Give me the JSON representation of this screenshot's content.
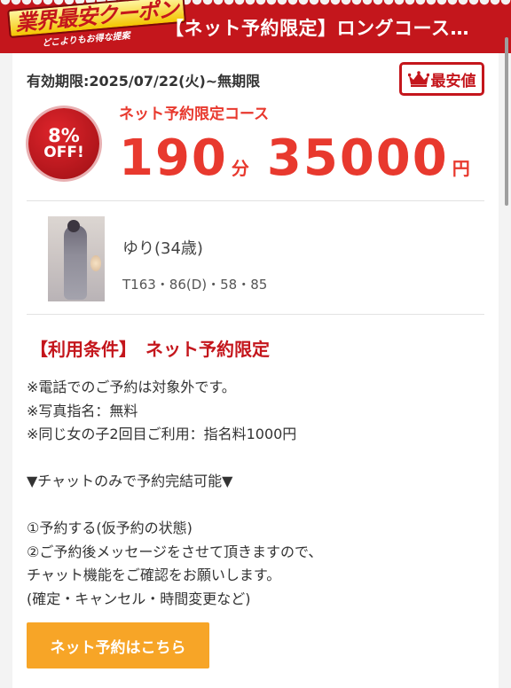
{
  "header": {
    "banner_main": "業界最安クーポン",
    "banner_sub": "どこよりもお得な提案",
    "title": "【ネット予約限定】ロングコース…"
  },
  "coupon": {
    "validity": "有効期限:2025/07/22(火)~無期限",
    "cheapest_label": "最安値",
    "discount_pct": "8%",
    "discount_off": "OFF!",
    "course_label": "ネット予約限定コース",
    "duration": "190",
    "duration_unit": "分",
    "price": "35000",
    "price_unit": "円"
  },
  "girl": {
    "name": "ゆり(34歳)",
    "stats": "T163・86(D)・58・85"
  },
  "terms": {
    "title": "【利用条件】　ネット予約限定",
    "lines": [
      "※電話でのご予約は対象外です。",
      "※写真指名：無料",
      "※同じ女の子2回目ご利用：指名料1000円",
      "",
      "▼チャットのみで予約完結可能▼",
      "",
      "①予約する(仮予約の状態)",
      "②ご予約後メッセージをさせて頂きますので、",
      "チャット機能をご確認をお願いします。",
      "(確定・キャンセル・時間変更など)"
    ]
  },
  "reserve_button": "ネット予約はこちら",
  "colors": {
    "brand_red": "#c4161c",
    "price_red": "#e8392e",
    "button_orange": "#f7a527"
  },
  "icons": {
    "cheapest": "crown-icon",
    "banner": "coupon-banner-icon"
  }
}
